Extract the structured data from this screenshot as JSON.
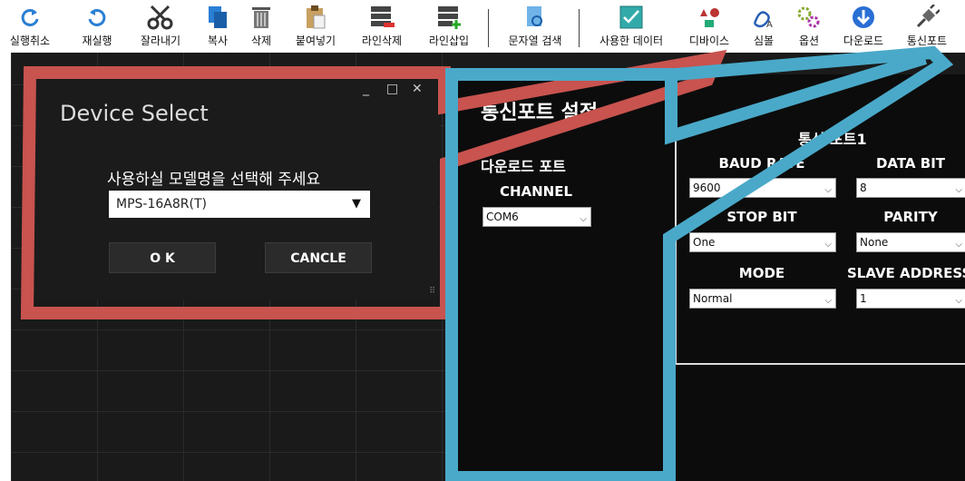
{
  "toolbar": {
    "items": [
      {
        "label": "실행취소",
        "icon": "undo-icon"
      },
      {
        "label": "재실행",
        "icon": "redo-icon"
      },
      {
        "label": "잘라내기",
        "icon": "scissors-icon"
      },
      {
        "label": "복사",
        "icon": "copy-icon"
      },
      {
        "label": "삭제",
        "icon": "trash-icon"
      },
      {
        "label": "붙여넣기",
        "icon": "paste-icon"
      },
      {
        "label": "라인삭제",
        "icon": "line-delete-icon"
      },
      {
        "label": "라인삽입",
        "icon": "line-insert-icon"
      },
      {
        "label": "문자열 검색",
        "icon": "search-doc-icon"
      },
      {
        "label": "사용한 데이터",
        "icon": "data-icon"
      },
      {
        "label": "디바이스",
        "icon": "device-icon"
      },
      {
        "label": "심볼",
        "icon": "symbol-icon"
      },
      {
        "label": "옵션",
        "icon": "options-icon"
      },
      {
        "label": "다운로드",
        "icon": "download-icon"
      },
      {
        "label": "통신포트",
        "icon": "plug-icon"
      }
    ]
  },
  "port_panel": {
    "title": "통신포트 설정",
    "download_port": "다운로드 포트",
    "channel_label": "CHANNEL",
    "channel_value": "COM6",
    "port1_label": "통신 포트1",
    "baud_label": "BAUD RATE",
    "baud_value": "9600",
    "data_bit_label": "DATA BIT",
    "data_bit_value": "8",
    "stop_bit_label": "STOP BIT",
    "stop_bit_value": "One",
    "parity_label": "PARITY",
    "parity_value": "None",
    "mode_label": "MODE",
    "mode_value": "Normal",
    "slave_label": "SLAVE ADDRESS",
    "slave_value": "1"
  },
  "dialog": {
    "title": "Device Select",
    "minimize": "_",
    "maximize": "□",
    "close": "✕",
    "prompt": "사용하실 모델명을 선택해 주세요",
    "selected_model": "MPS-16A8R(T)",
    "ok_label": "O K",
    "cancel_label": "CANCLE"
  },
  "colors": {
    "annotation_red": "#c8534f",
    "annotation_blue": "#4aa9c9",
    "dialog_accent": "#2ea3cc"
  }
}
